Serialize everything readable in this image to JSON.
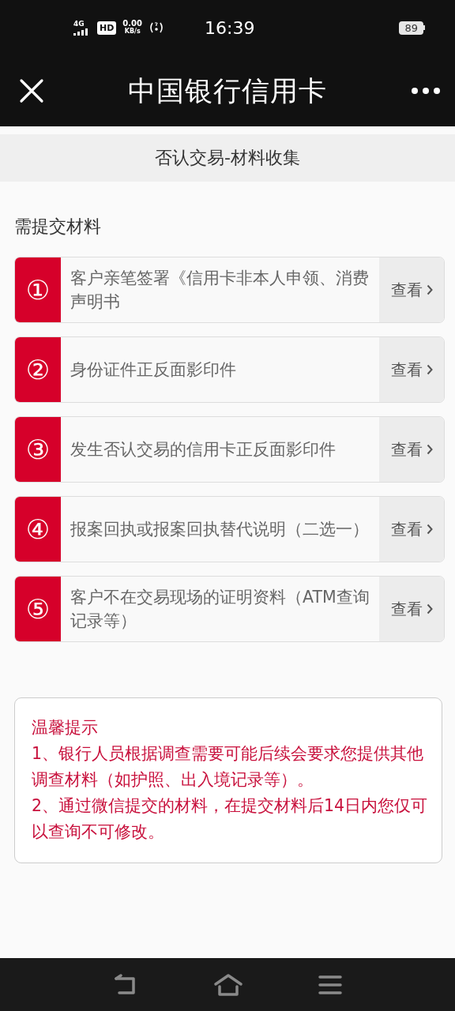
{
  "status_bar": {
    "network": "4G",
    "hd": "HD",
    "speed_value": "0.00",
    "speed_unit": "KB/s",
    "time": "16:39",
    "battery": "89"
  },
  "nav_bar": {
    "title": "中国银行信用卡"
  },
  "page_header": {
    "title": "否认交易-材料收集"
  },
  "section_title": "需提交材料",
  "materials": [
    {
      "number": "①",
      "text": "客户亲笔签署《信用卡非本人申领、消费声明书",
      "action": "查看"
    },
    {
      "number": "②",
      "text": "身份证件正反面影印件",
      "action": "查看"
    },
    {
      "number": "③",
      "text": "发生否认交易的信用卡正反面影印件",
      "action": "查看"
    },
    {
      "number": "④",
      "text": "报案回执或报案回执替代说明（二选一）",
      "action": "查看"
    },
    {
      "number": "⑤",
      "text": "客户不在交易现场的证明资料（ATM查询记录等）",
      "action": "查看"
    }
  ],
  "notice": {
    "title": "温馨提示",
    "lines": [
      "1、银行人员根据调查需要可能后续会要求您提供其他调查材料（如护照、出入境记录等）。",
      "2、通过微信提交的材料，在提交材料后14日内您仅可以查询不可修改。"
    ]
  }
}
